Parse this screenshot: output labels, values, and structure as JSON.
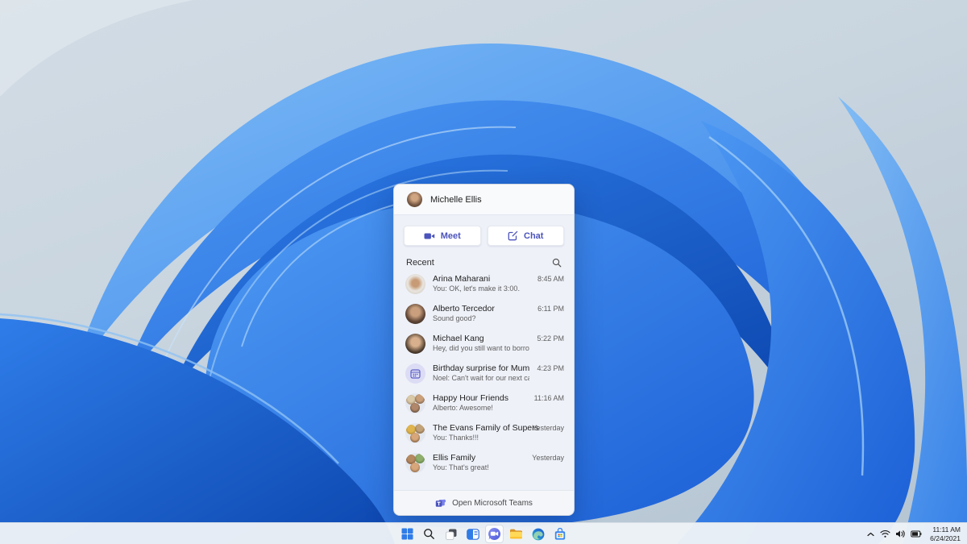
{
  "colors": {
    "accent": "#4b53bc",
    "wallpaper_blue": "#2f7de9",
    "panel_bg": "#eef1f8",
    "taskbar_bg": "#eef2f7"
  },
  "chat_panel": {
    "user_name": "Michelle Ellis",
    "meet_button": "Meet",
    "chat_button": "Chat",
    "recent_label": "Recent",
    "search_icon": "search-icon",
    "conversations": [
      {
        "name": "Arina Maharani",
        "preview": "You: OK, let's make it 3:00.",
        "time": "8:45 AM",
        "avatar": "person"
      },
      {
        "name": "Alberto Tercedor",
        "preview": "Sound good?",
        "time": "6:11 PM",
        "avatar": "person"
      },
      {
        "name": "Michael Kang",
        "preview": "Hey, did you still want to borrow the notes?",
        "time": "5:22 PM",
        "avatar": "person"
      },
      {
        "name": "Birthday surprise for Mum",
        "preview": "Noel: Can't wait for our next catch up!",
        "time": "4:23 PM",
        "avatar": "calendar-event"
      },
      {
        "name": "Happy Hour Friends",
        "preview": "Alberto: Awesome!",
        "time": "11:16 AM",
        "avatar": "group"
      },
      {
        "name": "The Evans Family of Supers",
        "preview": "You: Thanks!!!",
        "time": "Yesterday",
        "avatar": "group"
      },
      {
        "name": "Ellis Family",
        "preview": "You: That's great!",
        "time": "Yesterday",
        "avatar": "group"
      }
    ],
    "footer_label": "Open Microsoft Teams"
  },
  "taskbar": {
    "app_icons": [
      {
        "name": "start"
      },
      {
        "name": "search"
      },
      {
        "name": "task-view"
      },
      {
        "name": "widgets"
      },
      {
        "name": "chat",
        "active": true
      },
      {
        "name": "file-explorer"
      },
      {
        "name": "edge"
      },
      {
        "name": "store"
      }
    ],
    "tray": {
      "icons": [
        "chevron-up",
        "wifi",
        "volume",
        "battery"
      ],
      "time": "11:11 AM",
      "date": "6/24/2021"
    }
  }
}
